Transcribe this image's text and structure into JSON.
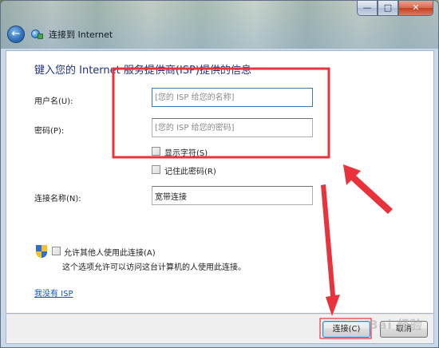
{
  "window": {
    "caption": {
      "minimize": "—",
      "maximize": "□",
      "close": "✕"
    },
    "nav_title": "连接到 Internet",
    "back_icon": "back-arrow-icon",
    "app_icon": "network-connection-icon"
  },
  "form": {
    "heading": "键入您的 Internet 服务提供商(ISP)提供的信息",
    "username": {
      "label": "用户名(U):",
      "value": "",
      "placeholder": "[您的 ISP 给您的名称]"
    },
    "password": {
      "label": "密码(P):",
      "value": "",
      "placeholder": "[您的 ISP 给您的密码]"
    },
    "show_chars": {
      "label": "显示字符(S)",
      "checked": false
    },
    "remember_password": {
      "label": "记住此密码(R)",
      "checked": false
    },
    "connection_name": {
      "label": "连接名称(N):",
      "value": "宽带连接"
    },
    "allow_others": {
      "label": "允许其他人使用此连接(A)",
      "checked": false,
      "description": "这个选项允许可以访问这台计算机的人使用此连接。",
      "icon": "uac-shield-icon"
    },
    "no_isp_link": "我没有 ISP"
  },
  "footer": {
    "connect_button": "连接(C)",
    "cancel_button": "取消"
  },
  "annotations": {
    "highlight_color": "#e8323c",
    "watermark": "Bai 经验"
  }
}
